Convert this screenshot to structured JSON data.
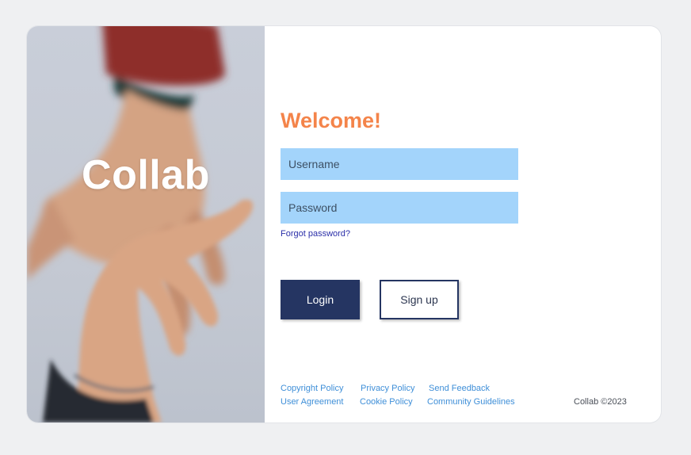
{
  "hero": {
    "brand": "Collab"
  },
  "form": {
    "welcome": "Welcome!",
    "username_placeholder": "Username",
    "password_placeholder": "Password",
    "forgot_password": "Forgot password?",
    "login_label": "Login",
    "signup_label": "Sign up"
  },
  "footer": {
    "links": [
      "Copyright Policy",
      "Privacy Policy",
      "Send Feedback",
      "User Agreement",
      "Cookie Policy",
      "Community Guidelines"
    ],
    "copyright": "Collab ©2023"
  },
  "colors": {
    "accent": "#f4844a",
    "primary": "#253562",
    "field_bg": "#a3d4fb",
    "link": "#3f8fd8",
    "page_bg": "#eff0f2"
  }
}
